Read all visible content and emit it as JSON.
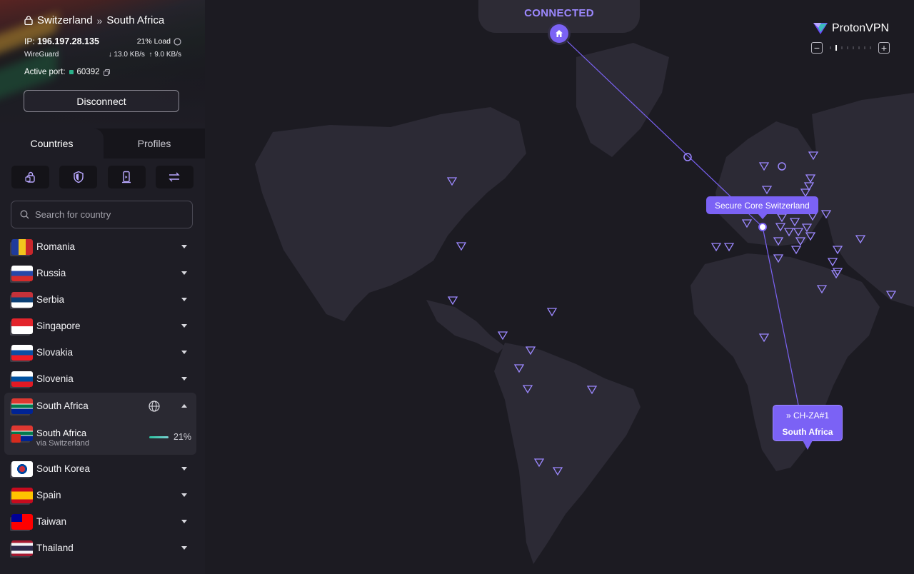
{
  "header": {
    "entry_country": "Switzerland",
    "exit_country": "South Africa",
    "ip_label": "IP:",
    "ip_value": "196.197.28.135",
    "load": "21% Load",
    "protocol": "WireGuard",
    "download": "13.0 KB/s",
    "upload": "9.0 KB/s",
    "port_label": "Active port:",
    "port_value": "60392",
    "disconnect_label": "Disconnect"
  },
  "tabs": {
    "countries": "Countries",
    "profiles": "Profiles"
  },
  "filters": [
    "secure-core-icon",
    "netshield-icon",
    "streaming-icon",
    "p2p-icon"
  ],
  "search": {
    "placeholder": "Search for country"
  },
  "countries": [
    {
      "name": "Romania",
      "flag": "romania"
    },
    {
      "name": "Russia",
      "flag": "russia"
    },
    {
      "name": "Serbia",
      "flag": "serbia"
    },
    {
      "name": "Singapore",
      "flag": "singapore"
    },
    {
      "name": "Slovakia",
      "flag": "slovakia"
    },
    {
      "name": "Slovenia",
      "flag": "slovenia"
    },
    {
      "name": "South Africa",
      "flag": "south-africa",
      "expanded": true
    },
    {
      "name": "South Korea",
      "flag": "south-korea"
    },
    {
      "name": "Spain",
      "flag": "spain"
    },
    {
      "name": "Taiwan",
      "flag": "taiwan"
    },
    {
      "name": "Thailand",
      "flag": "thailand"
    }
  ],
  "expanded_server": {
    "name": "South Africa",
    "via": "via Switzerland",
    "load_percent": "21%",
    "load_fraction": 0.21
  },
  "map": {
    "status": "CONNECTED",
    "entry_tooltip": "Secure Core Switzerland",
    "server_name": "CH-ZA#1",
    "server_country": "South Africa",
    "brand": "ProtonVPN",
    "accent": "#7b62f5",
    "status_color": "#9c88ff"
  }
}
